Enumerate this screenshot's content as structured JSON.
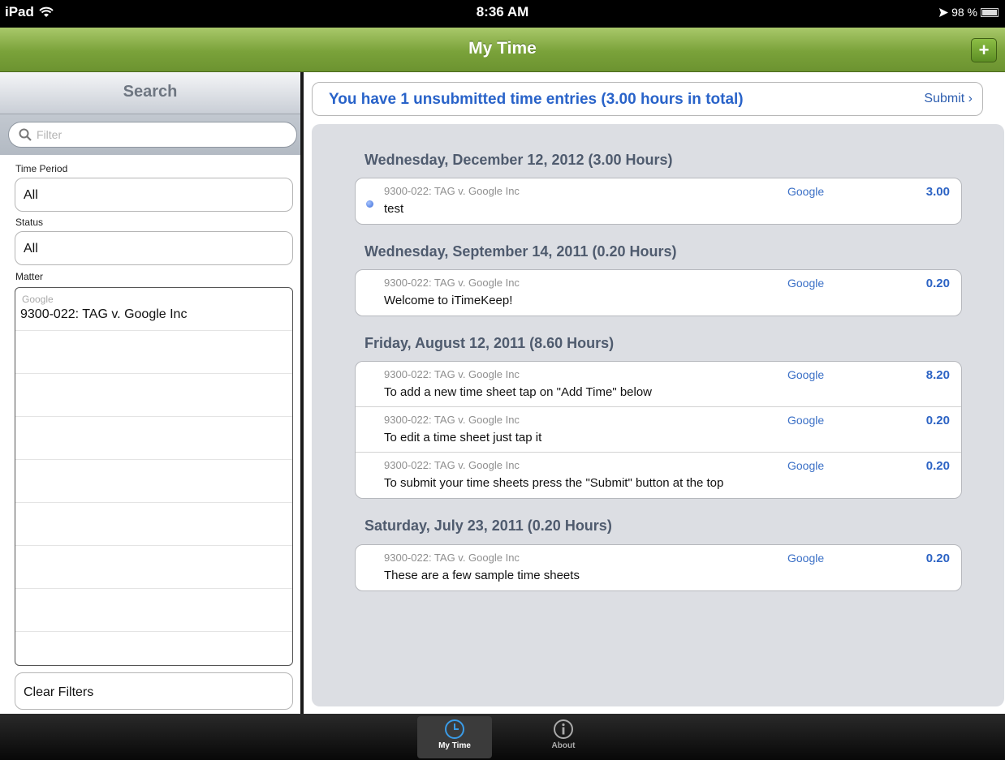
{
  "status_bar": {
    "device": "iPad",
    "time": "8:36 AM",
    "battery": "98 %"
  },
  "nav": {
    "title": "My Time",
    "add_label": "+"
  },
  "search_panel": {
    "title": "Search",
    "filter_placeholder": "Filter",
    "time_period_label": "Time Period",
    "time_period_value": "All",
    "status_label": "Status",
    "status_value": "All",
    "matter_label": "Matter",
    "matters": [
      {
        "client": "Google",
        "name": "9300-022:   TAG v. Google Inc"
      }
    ],
    "clear_label": "Clear Filters"
  },
  "banner": {
    "message": "You have 1 unsubmitted time entries (3.00 hours in total)",
    "submit_label": "Submit ›"
  },
  "days": [
    {
      "header": "Wednesday, December 12, 2012   (3.00 Hours)",
      "entries": [
        {
          "matter": "9300-022: TAG v. Google Inc",
          "desc": "test",
          "client": "Google",
          "hours": "3.00",
          "unsubmitted": true
        }
      ]
    },
    {
      "header": "Wednesday, September 14, 2011   (0.20 Hours)",
      "entries": [
        {
          "matter": "9300-022: TAG v. Google Inc",
          "desc": "Welcome to iTimeKeep!",
          "client": "Google",
          "hours": "0.20",
          "unsubmitted": false
        }
      ]
    },
    {
      "header": "Friday, August 12, 2011   (8.60 Hours)",
      "entries": [
        {
          "matter": "9300-022: TAG v. Google Inc",
          "desc": "To add a new time sheet tap on \"Add Time\" below",
          "client": "Google",
          "hours": "8.20",
          "unsubmitted": false
        },
        {
          "matter": "9300-022: TAG v. Google Inc",
          "desc": "To edit a time sheet just tap it",
          "client": "Google",
          "hours": "0.20",
          "unsubmitted": false
        },
        {
          "matter": "9300-022: TAG v. Google Inc",
          "desc": "To submit your time sheets press the \"Submit\" button at the top",
          "client": "Google",
          "hours": "0.20",
          "unsubmitted": false
        }
      ]
    },
    {
      "header": "Saturday, July 23, 2011   (0.20 Hours)",
      "entries": [
        {
          "matter": "9300-022: TAG v. Google Inc",
          "desc": "These are a few sample time sheets",
          "client": "Google",
          "hours": "0.20",
          "unsubmitted": false
        }
      ]
    }
  ],
  "tabs": [
    {
      "label": "My Time",
      "icon": "clock-icon",
      "active": true
    },
    {
      "label": "About",
      "icon": "info-icon",
      "active": false
    }
  ]
}
